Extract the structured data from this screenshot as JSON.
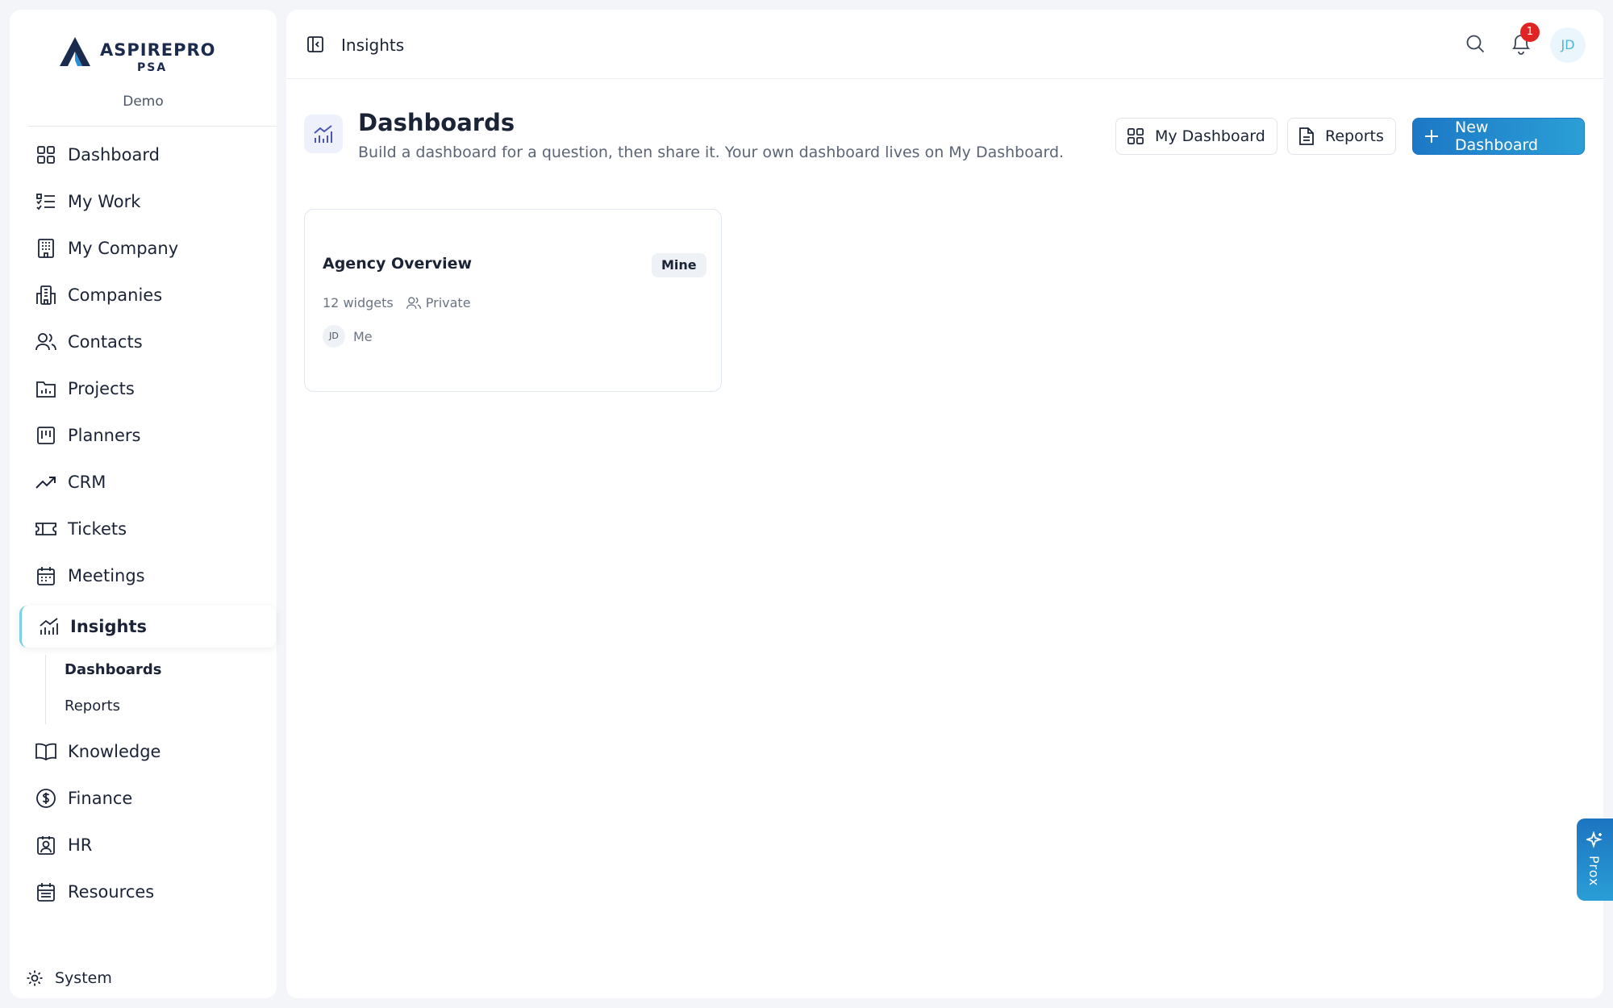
{
  "brand": {
    "name": "ASPIREPRO",
    "sub": "PSA",
    "workspace": "Demo"
  },
  "sidebar": {
    "items": [
      {
        "label": "Dashboard",
        "icon": "grid-icon"
      },
      {
        "label": "My Work",
        "icon": "checklist-icon"
      },
      {
        "label": "My Company",
        "icon": "building-icon"
      },
      {
        "label": "Companies",
        "icon": "buildings-icon"
      },
      {
        "label": "Contacts",
        "icon": "users-icon"
      },
      {
        "label": "Projects",
        "icon": "folder-chart-icon"
      },
      {
        "label": "Planners",
        "icon": "kanban-icon"
      },
      {
        "label": "CRM",
        "icon": "trending-up-icon"
      },
      {
        "label": "Tickets",
        "icon": "ticket-icon"
      },
      {
        "label": "Meetings",
        "icon": "calendar-icon"
      },
      {
        "label": "Insights",
        "icon": "bar-chart-icon",
        "active": true
      },
      {
        "label": "Knowledge",
        "icon": "book-icon"
      },
      {
        "label": "Finance",
        "icon": "dollar-icon"
      },
      {
        "label": "HR",
        "icon": "badge-icon"
      },
      {
        "label": "Resources",
        "icon": "calendar-grid-icon"
      }
    ],
    "subitems": [
      {
        "label": "Dashboards",
        "current": true
      },
      {
        "label": "Reports",
        "current": false
      }
    ],
    "system_label": "System"
  },
  "topbar": {
    "breadcrumb": "Insights",
    "notification_count": "1",
    "avatar_initials": "JD"
  },
  "page": {
    "title": "Dashboards",
    "subtitle": "Build a dashboard for a question, then share it. Your own dashboard lives on My Dashboard.",
    "buttons": {
      "my_dashboard": "My Dashboard",
      "reports": "Reports",
      "new_dashboard": "New Dashboard"
    }
  },
  "cards": [
    {
      "title": "Agency Overview",
      "tag": "Mine",
      "widgets": "12 widgets",
      "visibility": "Private",
      "owner_initials": "JD",
      "owner_name": "Me"
    }
  ],
  "assistant": {
    "label": "Prox"
  },
  "colors": {
    "accent": "#2b8fd3",
    "badge": "#e02424",
    "active_border": "#7fd0e6"
  }
}
